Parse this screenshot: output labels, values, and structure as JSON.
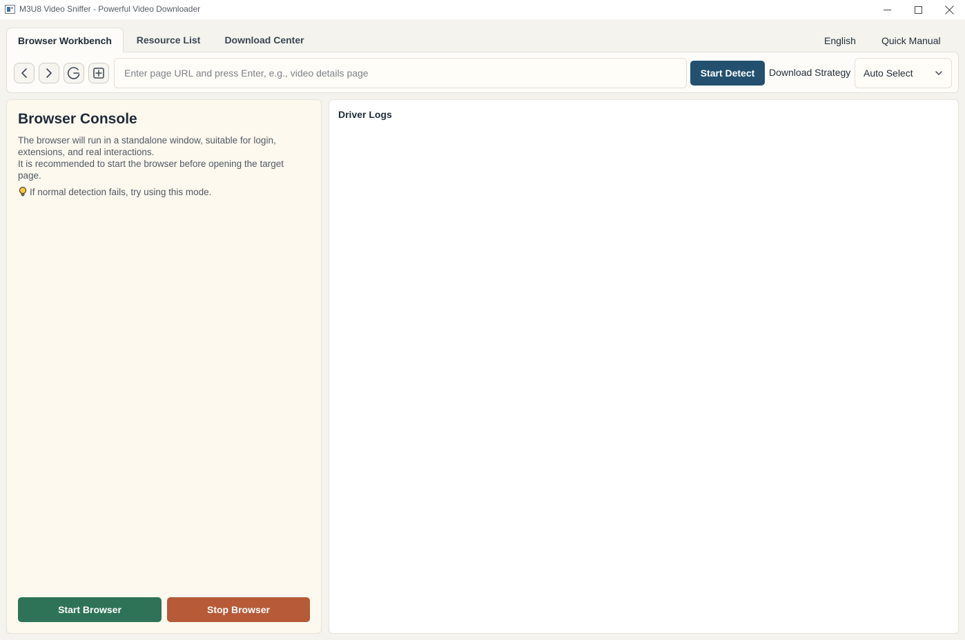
{
  "window": {
    "title": "M3U8 Video Sniffer - Powerful Video Downloader",
    "app_icon": "app-window-icon",
    "controls": [
      "minimize-icon",
      "maximize-icon",
      "close-icon"
    ]
  },
  "tabs": [
    {
      "label": "Browser Workbench",
      "active": true
    },
    {
      "label": "Resource List",
      "active": false
    },
    {
      "label": "Download Center",
      "active": false
    }
  ],
  "header_links": {
    "language": "English",
    "manual": "Quick Manual"
  },
  "toolbar": {
    "nav_icons": [
      "chevron-left-icon",
      "chevron-right-icon",
      "refresh-icon",
      "new-tab-icon"
    ],
    "url_placeholder": "Enter page URL and press Enter, e.g., video details page",
    "url_value": "",
    "detect_label": "Start Detect",
    "strategy_label": "Download Strategy",
    "strategy_selected": "Auto Select"
  },
  "console": {
    "title": "Browser Console",
    "desc_line1": "The browser will run in a standalone window, suitable for login, extensions, and real interactions.",
    "desc_line2": "It is recommended to start the browser before opening the target page.",
    "tip_icon": "lightbulb-icon",
    "tip": "If normal detection fails, try using this mode.",
    "start_label": "Start Browser",
    "stop_label": "Stop Browser"
  },
  "logs": {
    "title": "Driver Logs",
    "entries": []
  },
  "colors": {
    "accent_blue": "#22506e",
    "start_green": "#2e7357",
    "stop_orange": "#b65a38",
    "panel_cream": "#fef9ef",
    "background": "#f4f3ee"
  }
}
